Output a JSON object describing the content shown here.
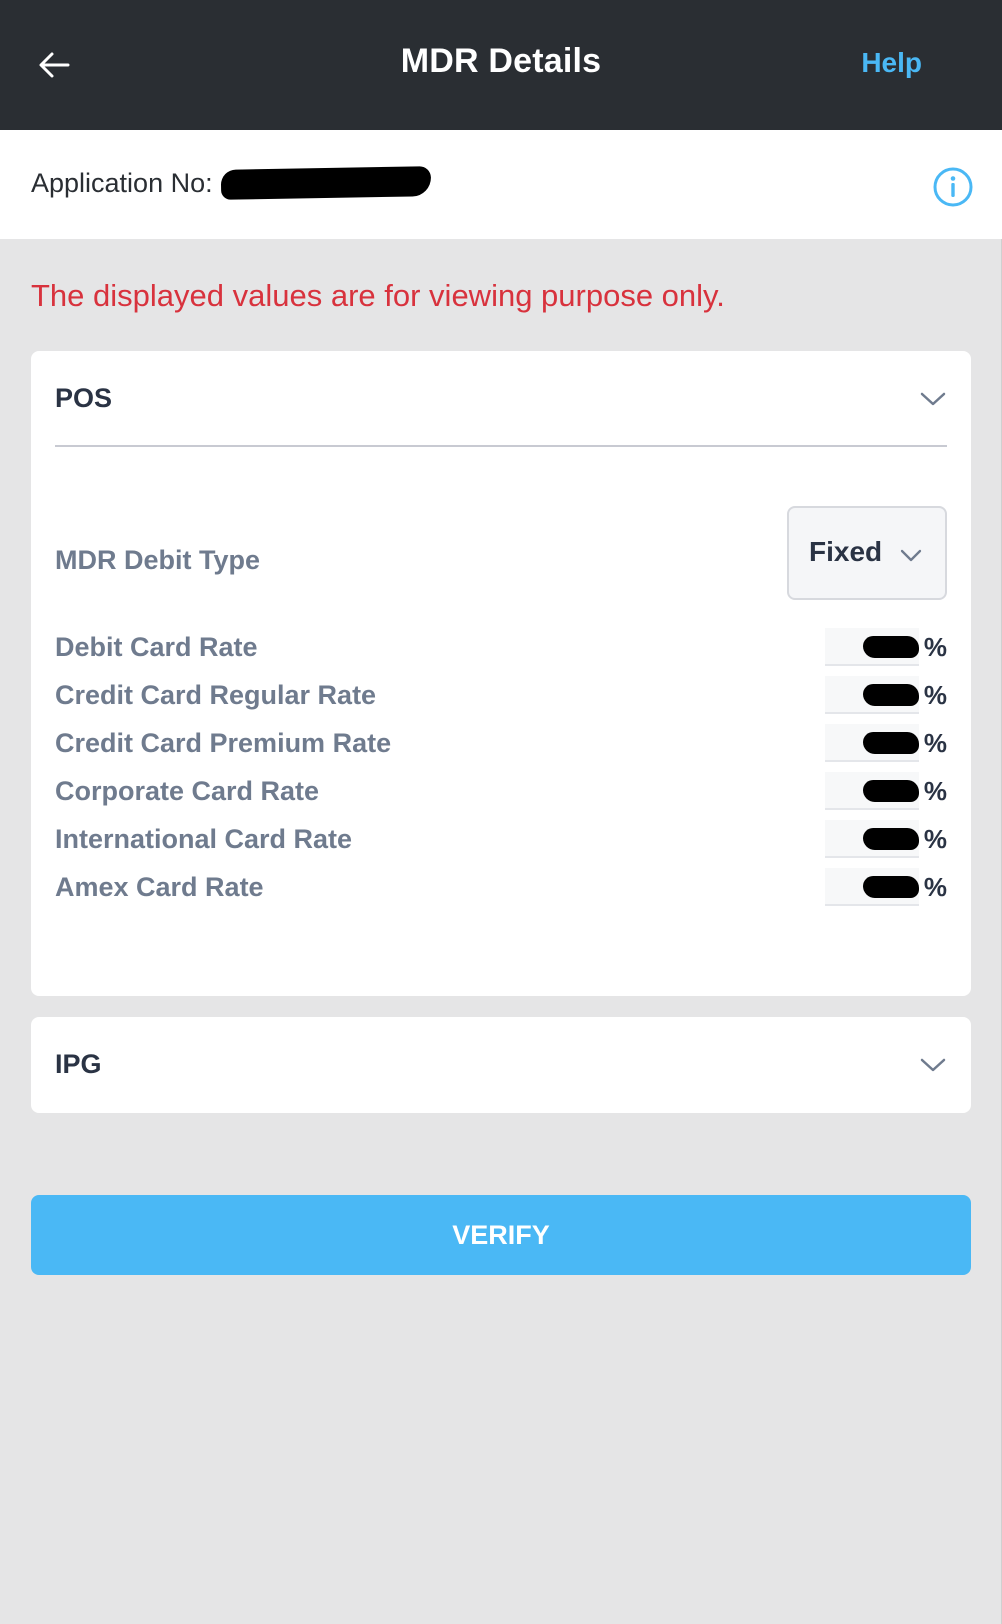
{
  "header": {
    "title": "MDR Details",
    "help_label": "Help",
    "background_color": "#2a2e33",
    "accent_color": "#4ab8f5"
  },
  "application": {
    "label": "Application No:"
  },
  "notice": {
    "text": "The displayed values are for viewing purpose only.",
    "color": "#d8323d"
  },
  "sections": [
    {
      "title": "POS",
      "expanded": true,
      "mdr_debit_type": {
        "label": "MDR Debit Type",
        "selected": "Fixed"
      },
      "rates": [
        {
          "label": "Debit Card Rate",
          "unit": "%"
        },
        {
          "label": "Credit Card Regular Rate",
          "unit": "%"
        },
        {
          "label": "Credit Card Premium Rate",
          "unit": "%"
        },
        {
          "label": "Corporate Card Rate",
          "unit": "%"
        },
        {
          "label": "International Card Rate",
          "unit": "%"
        },
        {
          "label": "Amex Card Rate",
          "unit": "%"
        }
      ]
    },
    {
      "title": "IPG",
      "expanded": false
    }
  ],
  "verify_label": "VERIFY",
  "icons": {
    "back": "arrow-left-icon",
    "info": "info-circle-icon",
    "expand": "chevron-down-icon"
  }
}
